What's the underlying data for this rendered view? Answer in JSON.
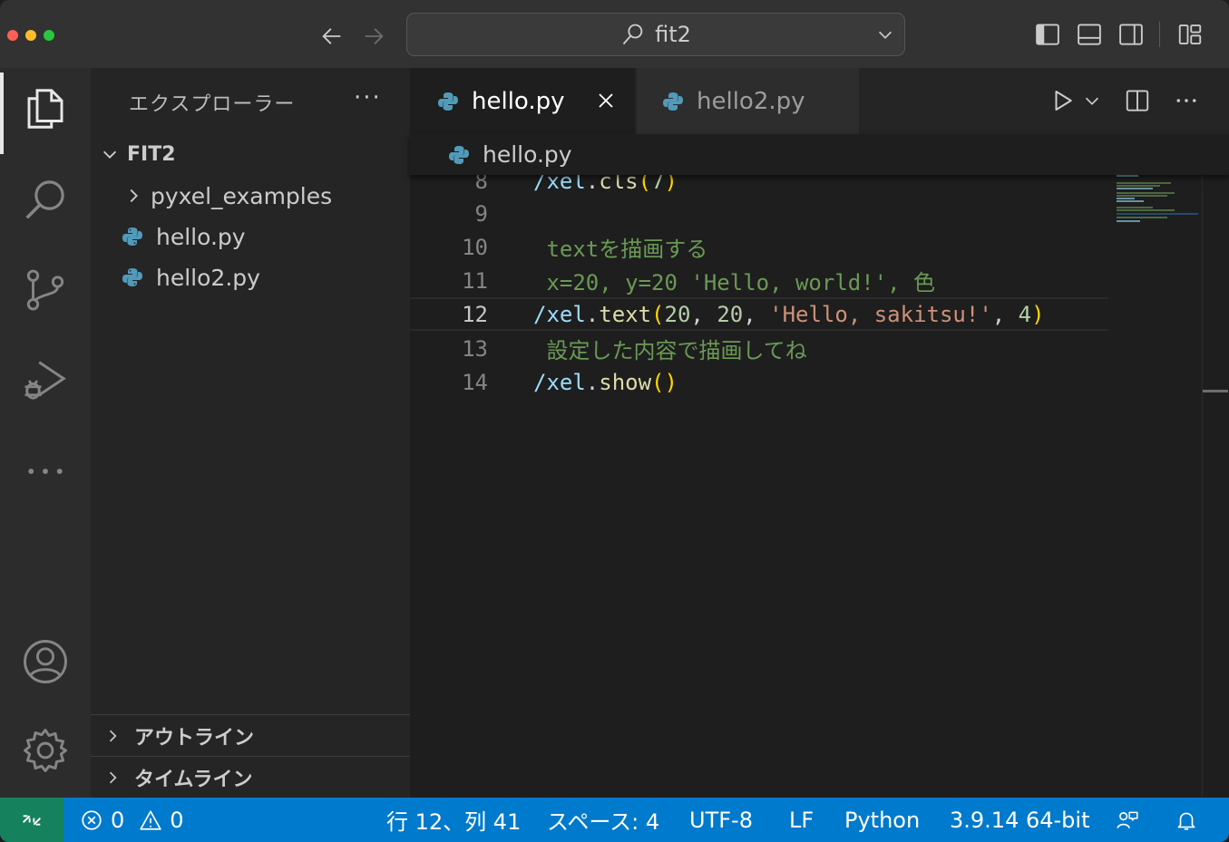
{
  "titlebar": {
    "search_text": "fit2",
    "back_icon": "arrow-left-icon",
    "forward_icon": "arrow-right-icon"
  },
  "sidebar": {
    "title": "エクスプローラー",
    "more": "···",
    "root_folder": "FIT2",
    "items": [
      {
        "label": "pyxel_examples",
        "type": "folder"
      },
      {
        "label": "hello.py",
        "type": "python-file"
      },
      {
        "label": "hello2.py",
        "type": "python-file"
      }
    ],
    "outline_label": "アウトライン",
    "timeline_label": "タイムライン"
  },
  "editor": {
    "tabs": [
      {
        "label": "hello.py",
        "active": true
      },
      {
        "label": "hello2.py",
        "active": false
      }
    ],
    "breadcrumb": "hello.py",
    "lines": [
      {
        "num": "8",
        "text": "/xel.cls(7)"
      },
      {
        "num": "9",
        "text": ""
      },
      {
        "num": "10",
        "text": " textを描画する"
      },
      {
        "num": "11",
        "text": " x=20, y=20 'Hello, world!', 色"
      },
      {
        "num": "12",
        "text": "/xel.text(20, 20, 'Hello, sakitsu!', 4)"
      },
      {
        "num": "13",
        "text": " 設定した内容で描画してね"
      },
      {
        "num": "14",
        "text": "/xel.show()"
      }
    ],
    "current_line": "12"
  },
  "statusbar": {
    "errors": "0",
    "warnings": "0",
    "position": "行 12、列 41",
    "indent": "スペース: 4",
    "encoding": "UTF-8",
    "eol": "LF",
    "language": "Python",
    "interpreter": "3.9.14 64-bit"
  },
  "colors": {
    "statusbar_bg": "#007acc",
    "remote_bg": "#16825d",
    "comment": "#6a9955",
    "string": "#ce9178",
    "function": "#dcdcaa",
    "variable": "#9cdcfe",
    "number": "#b5cea8"
  }
}
